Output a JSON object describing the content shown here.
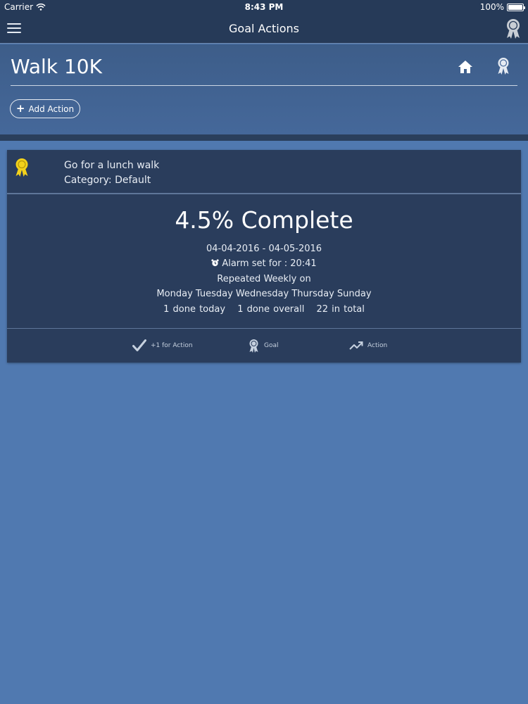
{
  "status_bar": {
    "carrier": "Carrier",
    "time": "8:43 PM",
    "battery": "100%"
  },
  "nav": {
    "title": "Goal Actions",
    "menu_icon": "hamburger-menu-icon",
    "award_icon": "award-ribbon-icon"
  },
  "goal": {
    "title": "Walk 10K",
    "add_action_label": "Add Action"
  },
  "action": {
    "name": "Go for a lunch walk",
    "category": "Category: Default",
    "percent_complete": "4.5% Complete",
    "date_range": "04-04-2016 - 04-05-2016",
    "alarm": "Alarm set for : 20:41",
    "repeat": "Repeated Weekly on",
    "days": "Monday Tuesday Wednesday Thursday Sunday",
    "done_today": "1 done today",
    "done_overall": "1 done overall",
    "total": "22 in total",
    "footer": {
      "plus_one": "+1 for Action",
      "goal": "Goal",
      "action": "Action"
    }
  },
  "colors": {
    "background": "#5079b0",
    "nav_bar": "#263a58",
    "card": "#2a3d5c",
    "award_gold": "#f3d21b",
    "award_grey": "#c8cdd4"
  }
}
